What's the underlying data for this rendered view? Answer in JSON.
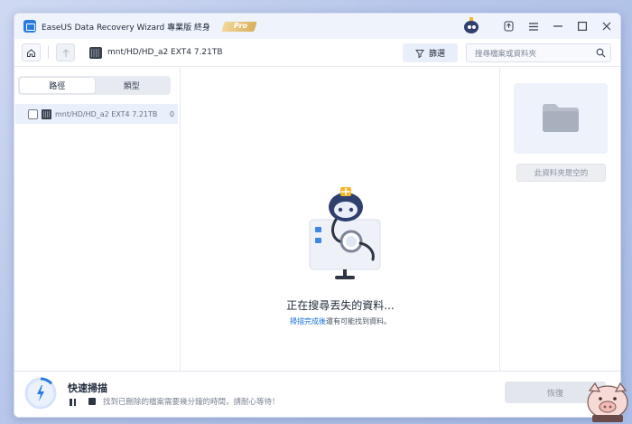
{
  "app": {
    "title": "EaseUS Data Recovery Wizard 專業版 終身",
    "badge": "Pro"
  },
  "toolbar": {
    "path": "mnt/HD/HD_a2 EXT4  7.21TB",
    "filter_label": "篩選",
    "search_placeholder": "搜尋檔案或資料夾"
  },
  "sidebar": {
    "tabs": [
      {
        "label": "路徑",
        "active": true
      },
      {
        "label": "類型",
        "active": false
      }
    ],
    "tree": [
      {
        "label": "mnt/HD/HD_a2 EXT4  7.21TB",
        "count": "0"
      }
    ]
  },
  "main": {
    "status_title": "正在搜尋丟失的資料...",
    "status_link": "掃描完成後",
    "status_rest": "還有可能找到資料。"
  },
  "preview": {
    "empty_label": "此資料夾是空的"
  },
  "bottom": {
    "scan_title": "快速掃描",
    "message": "找到已刪除的檔案需要幾分鐘的時間，請耐心等待！",
    "recover_label": "恢復"
  },
  "colors": {
    "accent": "#1d6fd8",
    "robot_body": "#2f3f6e",
    "antenna": "#f4b62a",
    "panel_bg": "#edf2fb"
  }
}
